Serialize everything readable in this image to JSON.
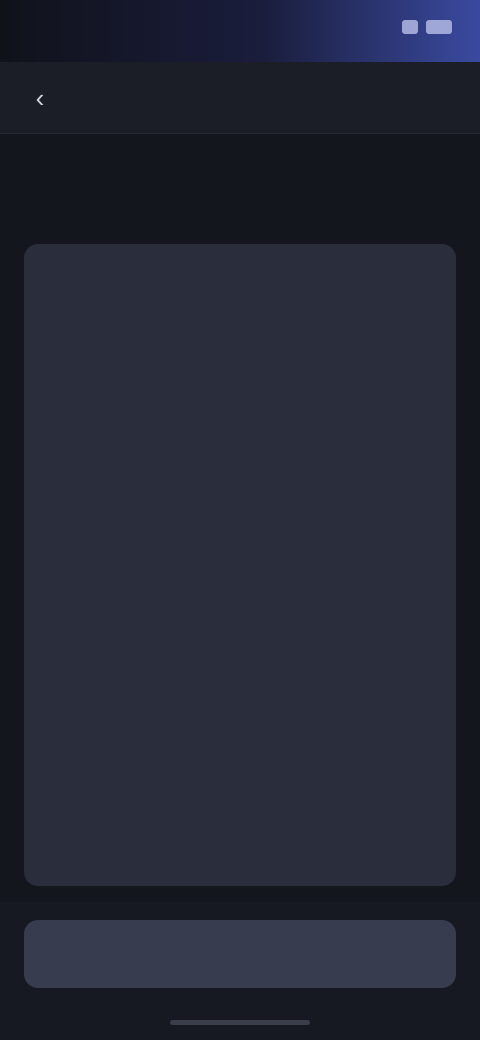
{
  "status_bar": {
    "time": "",
    "icons": [
      "signal-icon",
      "battery-icon"
    ]
  },
  "header": {
    "title": "",
    "back_icon": "chevron-left-icon"
  },
  "section": {
    "title": "",
    "subtitle": ""
  },
  "document": {
    "body": "",
    "footer": ""
  },
  "action": {
    "primary_label": ""
  },
  "colors": {
    "background": "#14161e",
    "card": "#2a2e3c",
    "button": "#373c4e",
    "accent": "#3a4aa0"
  }
}
